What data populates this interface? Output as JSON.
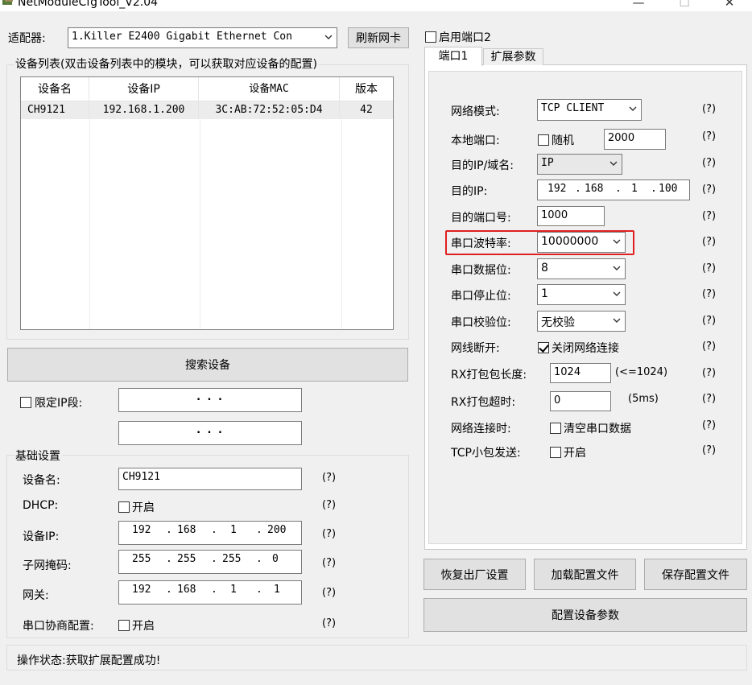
{
  "window": {
    "title": "NetModuleCfgTool_V2.04",
    "minimize": "—",
    "maximize": "☐",
    "close": "✕"
  },
  "adapter": {
    "label": "适配器:",
    "value": "1.Killer E2400 Gigabit Ethernet Con",
    "refresh": "刷新网卡"
  },
  "device_list": {
    "legend": "设备列表(双击设备列表中的模块，可以获取对应设备的配置)",
    "columns": [
      "设备名",
      "设备IP",
      "设备MAC",
      "版本"
    ],
    "rows": [
      [
        "CH9121",
        "192.168.1.200",
        "3C:AB:72:52:05:D4",
        "42"
      ]
    ]
  },
  "search_button": "搜索设备",
  "ip_limit": {
    "label": "限定IP段:",
    "range1": ".     .     .",
    "range2": ".     .     ."
  },
  "basic": {
    "legend": "基础设置",
    "device_name_label": "设备名:",
    "device_name": "CH9121",
    "dhcp_label": "DHCP:",
    "dhcp_enable": "开启",
    "ip_label": "设备IP:",
    "ip": [
      "192",
      "168",
      "1",
      "200"
    ],
    "mask_label": "子网掩码:",
    "mask": [
      "255",
      "255",
      "255",
      "0"
    ],
    "gateway_label": "网关:",
    "gateway": [
      "192",
      "168",
      "1",
      "1"
    ],
    "serial_neg_label": "串口协商配置:",
    "serial_neg_enable": "开启",
    "help": "(?)"
  },
  "status": {
    "text": "操作状态:获取扩展配置成功!"
  },
  "port2": {
    "label": "启用端口2"
  },
  "tabs": {
    "port1": "端口1",
    "ext": "扩展参数"
  },
  "port1": {
    "net_mode_label": "网络模式:",
    "net_mode": "TCP CLIENT",
    "local_port_label": "本地端口:",
    "random": "随机",
    "local_port": "2000",
    "dest_type_label": "目的IP/域名:",
    "dest_type": "IP",
    "dest_ip_label": "目的IP:",
    "dest_ip": [
      "192",
      "168",
      "1",
      "100"
    ],
    "dest_port_label": "目的端口号:",
    "dest_port": "1000",
    "baud_label": "串口波特率:",
    "baud": "10000000",
    "data_bits_label": "串口数据位:",
    "data_bits": "8",
    "stop_bits_label": "串口停止位:",
    "stop_bits": "1",
    "parity_label": "串口校验位:",
    "parity": "无校验",
    "disconnect_label": "网线断开:",
    "disconnect_opt": "关闭网络连接",
    "rx_len_label": "RX打包包长度:",
    "rx_len": "1024",
    "rx_len_hint": "(<=1024)",
    "rx_timeout_label": "RX打包超时:",
    "rx_timeout": "0",
    "rx_timeout_unit": "(5ms)",
    "net_connect_label": "网络连接时:",
    "net_connect_opt": "清空串口数据",
    "tcp_small_label": "TCP小包发送:",
    "tcp_small_opt": "开启",
    "help": "(?)"
  },
  "buttons": {
    "restore": "恢复出厂设置",
    "load": "加载配置文件",
    "save": "保存配置文件",
    "apply": "配置设备参数"
  },
  "colors": {
    "highlight": "#e02020",
    "selected_row": "#ececec"
  }
}
